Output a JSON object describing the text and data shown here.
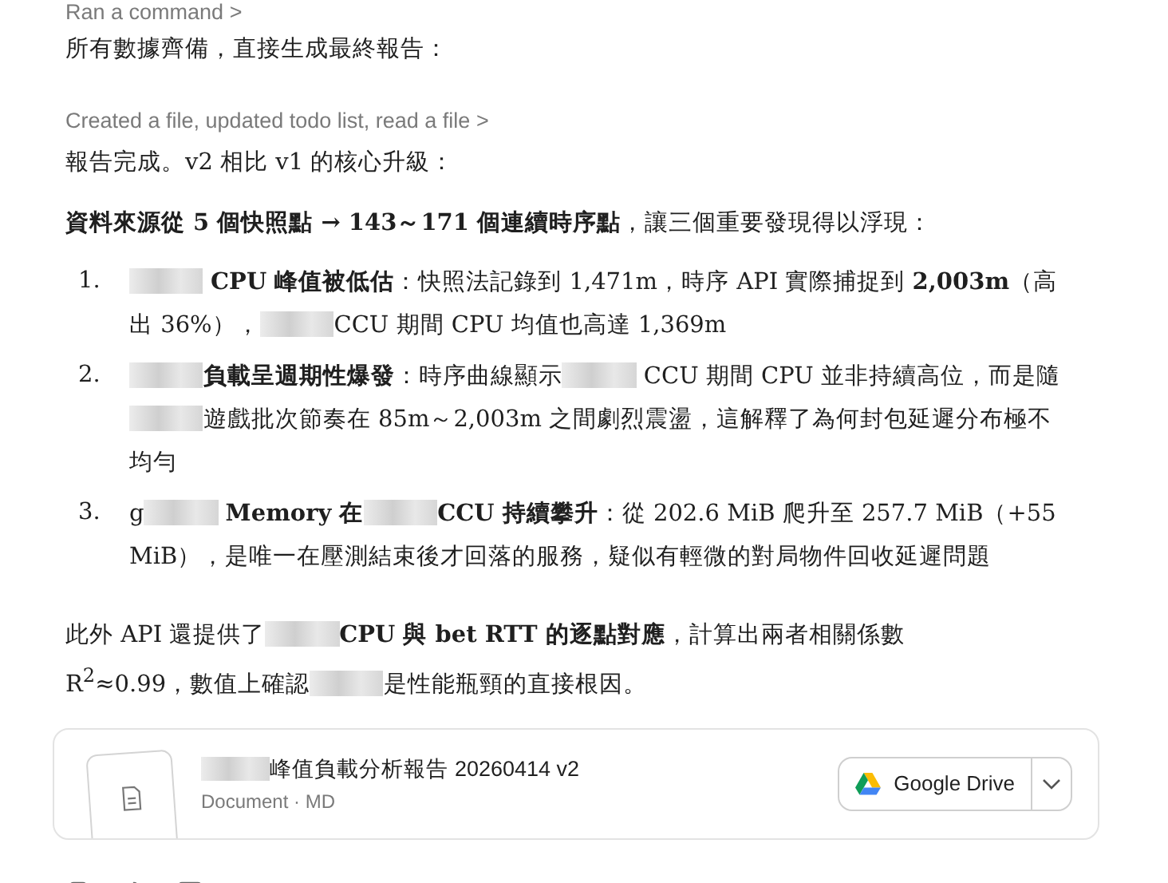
{
  "tool_step_top": {
    "label": "Ran a command",
    "chevron": ">"
  },
  "intro": "所有數據齊備，直接生成最終報告：",
  "tool_step": {
    "label": "Created a file, updated todo list, read a file",
    "chevron": ">"
  },
  "summary": "報告完成。v2 相比 v1 的核心升級：",
  "lead": [
    {
      "kind": "text",
      "text": "**資料來源從 5 個快照點 → 143～171 個連續時序點**，讓三個重要發現得以浮現："
    }
  ],
  "findings": [
    {
      "number": "1.",
      "segments": [
        {
          "kind": "redacted"
        },
        {
          "kind": "text",
          "text": " **CPU 峰值被低估**：快照法記錄到 1,471m，時序 API 實際捕捉到 **2,003m**（高出 36%），"
        },
        {
          "kind": "redacted"
        },
        {
          "kind": "text",
          "text": "CCU 期間 CPU 均值也高達 1,369m"
        }
      ]
    },
    {
      "number": "2.",
      "segments": [
        {
          "kind": "redacted"
        },
        {
          "kind": "text",
          "text": "**負載呈週期性爆發**：時序曲線顯示"
        },
        {
          "kind": "redacted"
        },
        {
          "kind": "text",
          "text": " CCU 期間 CPU 並非持續高位，而是隨"
        },
        {
          "kind": "redacted"
        },
        {
          "kind": "text",
          "text": "遊戲批次節奏在 85m～2,003m 之間劇烈震盪，這解釋了為何封包延遲分布極不均勻"
        }
      ]
    },
    {
      "number": "3.",
      "segments": [
        {
          "kind": "text",
          "text": "g"
        },
        {
          "kind": "redacted"
        },
        {
          "kind": "text",
          "text": " **Memory 在**"
        },
        {
          "kind": "redacted"
        },
        {
          "kind": "text",
          "text": "**CCU 持續攀升**：從 202.6 MiB 爬升至 257.7 MiB（+55 MiB），是唯一在壓測結束後才回落的服務，疑似有輕微的對局物件回收延遲問題"
        }
      ]
    }
  ],
  "closing": [
    {
      "kind": "text",
      "text": "此外 API 還提供了"
    },
    {
      "kind": "redacted"
    },
    {
      "kind": "text",
      "text": "**CPU 與 bet RTT 的逐點對應**，計算出兩者相關係數 R$^{2}$≈0.99，數值上確認"
    },
    {
      "kind": "redacted"
    },
    {
      "kind": "text",
      "text": "是性能瓶頸的直接根因。"
    }
  ],
  "file_card": {
    "title": [
      {
        "kind": "redacted"
      },
      {
        "kind": "text",
        "text": "峰值負載分析報告 20260414 v2"
      }
    ],
    "subtitle": "Document · MD",
    "action": "Google Drive"
  }
}
